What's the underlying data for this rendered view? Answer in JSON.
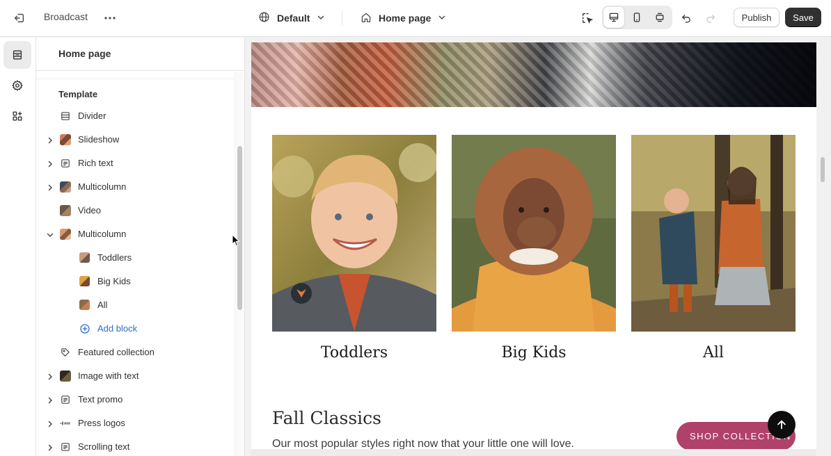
{
  "topbar": {
    "theme_name": "Broadcast",
    "more_icon": "more-horizontal-icon",
    "language_label": "Default",
    "page_label": "Home page",
    "publish_label": "Publish",
    "save_label": "Save"
  },
  "sidebar": {
    "title": "Home page",
    "section_label": "Template",
    "items": [
      {
        "label": "Divider",
        "icon": "layout-section-icon"
      },
      {
        "label": "Slideshow",
        "icon": "image-thumbnail"
      },
      {
        "label": "Rich text",
        "icon": "text-block-icon"
      },
      {
        "label": "Multicolumn",
        "icon": "image-thumbnail"
      },
      {
        "label": "Video",
        "icon": "image-thumbnail"
      },
      {
        "label": "Multicolumn",
        "icon": "image-thumbnail"
      },
      {
        "label": "Toddlers",
        "icon": "image-thumbnail"
      },
      {
        "label": "Big Kids",
        "icon": "image-thumbnail"
      },
      {
        "label": "All",
        "icon": "image-thumbnail"
      },
      {
        "label": "Add block",
        "icon": "plus-circle-icon"
      },
      {
        "label": "Featured collection",
        "icon": "tag-icon"
      },
      {
        "label": "Image with text",
        "icon": "image-thumbnail"
      },
      {
        "label": "Text promo",
        "icon": "text-block-icon"
      },
      {
        "label": "Press logos",
        "icon": "logo-thumbnail"
      },
      {
        "label": "Scrolling text",
        "icon": "text-block-icon"
      }
    ]
  },
  "preview": {
    "columns": [
      {
        "title": "Toddlers"
      },
      {
        "title": "Big Kids"
      },
      {
        "title": "All"
      }
    ],
    "fall_title": "Fall Classics",
    "fall_text": "Our most popular styles right now that your little one will love.",
    "shop_label": "SHOP COLLECTION",
    "accent_color": "#b0416a"
  }
}
